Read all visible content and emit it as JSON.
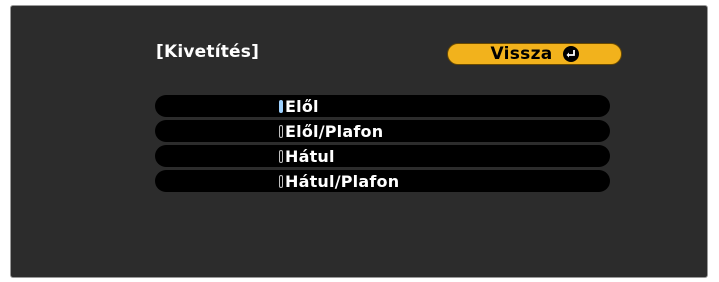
{
  "menu": {
    "title": "[Kivetítés]",
    "back_button_label": "Vissza",
    "options": [
      {
        "label": "Elől",
        "selected": true
      },
      {
        "label": "Elől/Plafon",
        "selected": false
      },
      {
        "label": "Hátul",
        "selected": false
      },
      {
        "label": "Hátul/Plafon",
        "selected": false
      }
    ]
  },
  "colors": {
    "panel_background": "#2c2c2c",
    "button_accent": "#f2b21c",
    "row_background": "#000000",
    "selected_radio": "#9fd2ff"
  },
  "icons": {
    "back_button_icon": "enter-icon"
  }
}
